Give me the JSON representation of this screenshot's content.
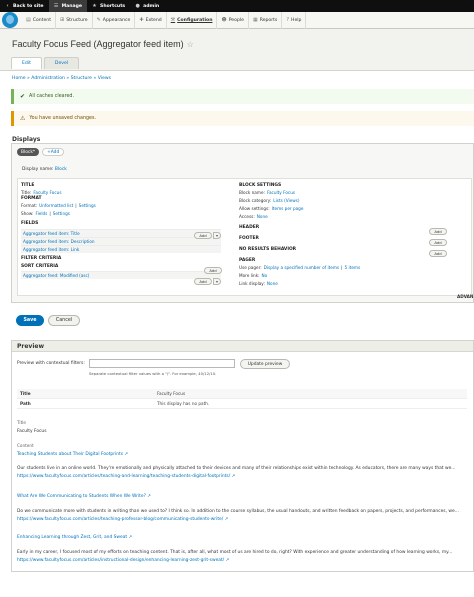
{
  "toolbar": {
    "back": "Back to site",
    "manage": "Manage",
    "shortcuts": "Shortcuts",
    "user": "admin"
  },
  "admin_menu": [
    "Content",
    "Structure",
    "Appearance",
    "Extend",
    "Configuration",
    "People",
    "Reports",
    "Help"
  ],
  "page": {
    "title": "Faculty Focus Feed (Aggregator feed item)",
    "tabs": [
      "Edit",
      "Devel"
    ]
  },
  "breadcrumb": "Home » Administration » Structure » Views",
  "messages": {
    "status": "All caches cleared.",
    "warning": "You have unsaved changes."
  },
  "displays": {
    "label": "Displays",
    "block_tab": "Block*",
    "add": "+Add",
    "display_name_label": "Display name:",
    "display_name_value": "Block"
  },
  "left": {
    "title_h": "TITLE",
    "title_k": "Title:",
    "title_v": "Faculty Focus",
    "format_h": "FORMAT",
    "format_k": "Format:",
    "format_v": "Unformatted list",
    "format_sep": "|",
    "format_settings": "Settings",
    "show_k": "Show:",
    "show_v": "Fields",
    "show_sep": "|",
    "show_settings": "Settings",
    "fields_h": "FIELDS",
    "fields": [
      "Aggregator feed item: Title",
      "Aggregator feed item: Description",
      "Aggregator feed item: Link"
    ],
    "filter_h": "FILTER CRITERIA",
    "sort_h": "SORT CRITERIA",
    "sort_item": "Aggregator feed: Modified (asc)",
    "add": "Add",
    "caret": "▾"
  },
  "right": {
    "block_settings_h": "BLOCK SETTINGS",
    "block_name_k": "Block name:",
    "block_name_v": "Faculty Focus",
    "block_cat_k": "Block category:",
    "block_cat_v": "Lists (Views)",
    "allow_k": "Allow settings:",
    "allow_v": "Items per page",
    "access_k": "Access:",
    "access_v": "None",
    "header_h": "HEADER",
    "footer_h": "FOOTER",
    "noresults_h": "NO RESULTS BEHAVIOR",
    "pager_h": "PAGER",
    "pager_k": "Use pager:",
    "pager_v": "Display a specified number of items",
    "pager_sep": "|",
    "pager_items": "5 items",
    "more_k": "More link:",
    "more_v": "No",
    "link_k": "Link display:",
    "link_v": "None",
    "add": "Add",
    "advanced": "ADVAN"
  },
  "buttons": {
    "save": "Save",
    "cancel": "Cancel"
  },
  "preview": {
    "heading": "Preview",
    "filter_label": "Preview with contextual filters:",
    "filter_value": "",
    "update": "Update preview",
    "help": "Separate contextual filter values with a \"/\". For example, 40/12/10.",
    "info": [
      {
        "k": "Title",
        "v": "Faculty Focus"
      },
      {
        "k": "Path",
        "v": "This display has no path."
      }
    ],
    "title_label": "Title",
    "title_value": "Faculty Focus",
    "content_label": "Content",
    "items": [
      {
        "title": "Teaching Students about Their Digital Footprints",
        "text": "Our students live in an online world. They're emotionally and physically attached to their devices and many of their relationships exist within technology. As educators, there are many ways that we...",
        "link": "https://www.facultyfocus.com/articles/teaching-and-learning/teaching-students-digital-footprints/"
      },
      {
        "title": "What Are We Communicating to Students When We Write?",
        "text": "Do we communicate more with students in writing than we used to? I think so. In addition to the course syllabus, the usual handouts, and written feedback on papers, projects, and performances, we...",
        "link": "https://www.facultyfocus.com/articles/teaching-professor-blog/communicating-students-write/"
      },
      {
        "title": "Enhancing Learning through Zest, Grit, and Sweat",
        "text": "Early in my career, I focused most of my efforts on teaching content. That is, after all, what most of us are hired to do, right? With experience and greater understanding of how learning works, my...",
        "link": "https://www.facultyfocus.com/articles/instructional-design/enhancing-learning-zest-grit-sweat/"
      }
    ]
  }
}
